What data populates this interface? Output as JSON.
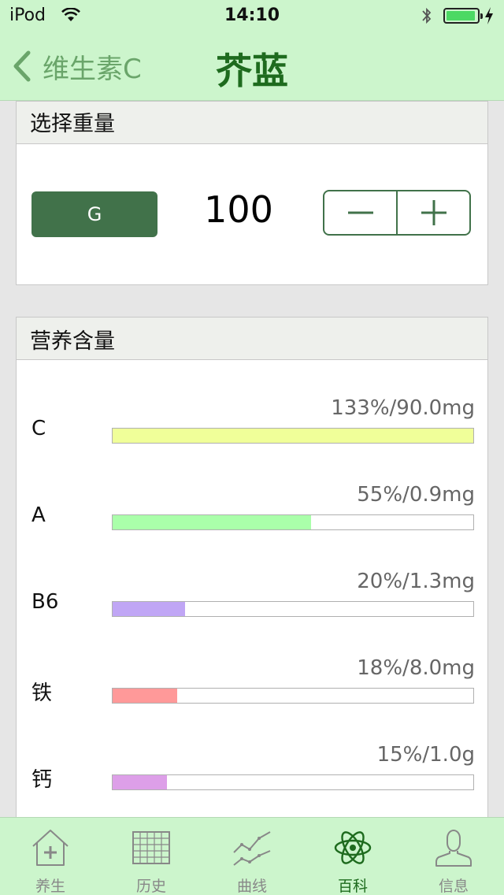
{
  "status_bar": {
    "carrier": "iPod",
    "time": "14:10"
  },
  "nav": {
    "back_label": "维生素C",
    "title": "芥蓝"
  },
  "weight_section": {
    "header": "选择重量",
    "unit": "G",
    "value": "100"
  },
  "nutrition_section": {
    "header": "营养含量",
    "items": [
      {
        "name": "C",
        "value": "133%/90.0mg",
        "fill": 1.0,
        "color": "#f0ff99"
      },
      {
        "name": "A",
        "value": "55%/0.9mg",
        "fill": 0.55,
        "color": "#aaffaa"
      },
      {
        "name": "B6",
        "value": "20%/1.3mg",
        "fill": 0.2,
        "color": "#c0a6f5"
      },
      {
        "name": "铁",
        "value": "18%/8.0mg",
        "fill": 0.18,
        "color": "#ff9999"
      },
      {
        "name": "钙",
        "value": "15%/1.0g",
        "fill": 0.15,
        "color": "#dd9fe8"
      }
    ]
  },
  "tabs": [
    {
      "label": "养生",
      "icon": "house-plus-icon"
    },
    {
      "label": "历史",
      "icon": "grid-calendar-icon"
    },
    {
      "label": "曲线",
      "icon": "line-chart-icon"
    },
    {
      "label": "百科",
      "icon": "atom-icon",
      "active": true
    },
    {
      "label": "信息",
      "icon": "user-icon"
    }
  ],
  "colors": {
    "accent_dark": "#41724a",
    "title_green": "#1e6b1e",
    "bar_background": "#ccf5cc"
  }
}
